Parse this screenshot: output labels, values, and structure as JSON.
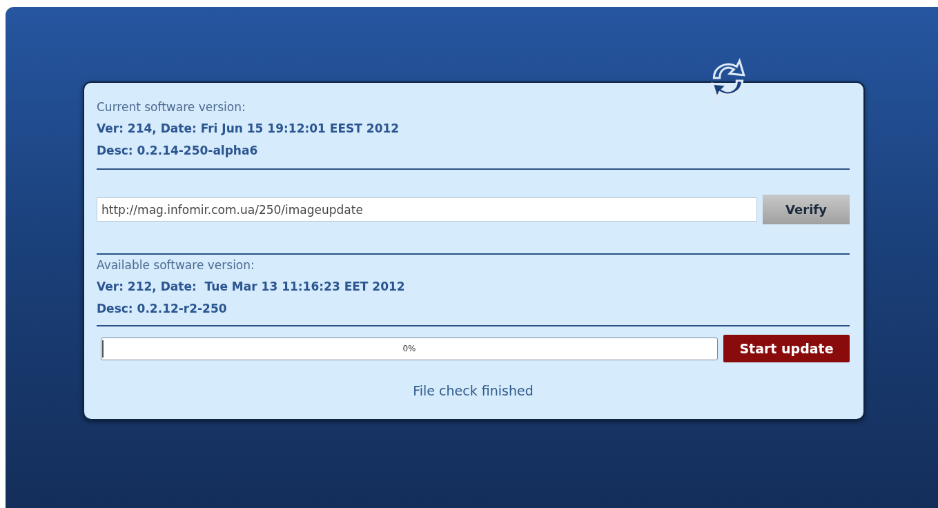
{
  "current": {
    "heading": "Current software version:",
    "version": "Ver: 214, Date: Fri Jun 15 19:12:01 EEST 2012",
    "desc": "Desc: 0.2.14-250-alpha6"
  },
  "url_field": {
    "value": "http://mag.infomir.com.ua/250/imageupdate"
  },
  "verify_button": "Verify",
  "available": {
    "heading": "Available software version:",
    "version": "Ver: 212, Date:  Tue Mar 13 11:16:23 EET 2012",
    "desc": "Desc: 0.2.12-r2-250"
  },
  "progress": {
    "level": 0,
    "reading": "0%"
  },
  "start_button": "Start update",
  "status": "File check finished"
}
